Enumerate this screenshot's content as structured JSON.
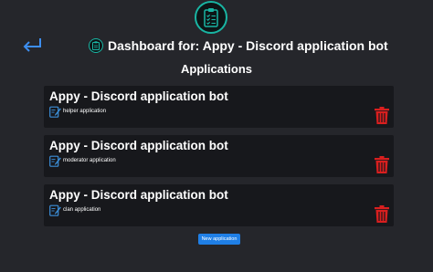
{
  "header": {
    "title": "Dashboard for: Appy - Discord application bot"
  },
  "main": {
    "heading": "Applications",
    "applications": [
      {
        "title": "Appy - Discord application bot",
        "subtitle": "helper application"
      },
      {
        "title": "Appy - Discord application bot",
        "subtitle": "moderator application"
      },
      {
        "title": "Appy - Discord application bot",
        "subtitle": "clan application"
      }
    ],
    "new_button_label": "New application"
  },
  "icons": {
    "logo": "clipboard-checklist-icon",
    "back": "return-arrow-icon",
    "edit": "edit-pencil-icon",
    "delete": "trash-icon"
  },
  "colors": {
    "background": "#25262b",
    "card": "#17181c",
    "accent_teal": "#19b5a3",
    "back_arrow": "#3d8ef0",
    "delete_red": "#d91f1f",
    "button_blue": "#1f7fe6",
    "edit_blue": "#3b8ed8"
  }
}
